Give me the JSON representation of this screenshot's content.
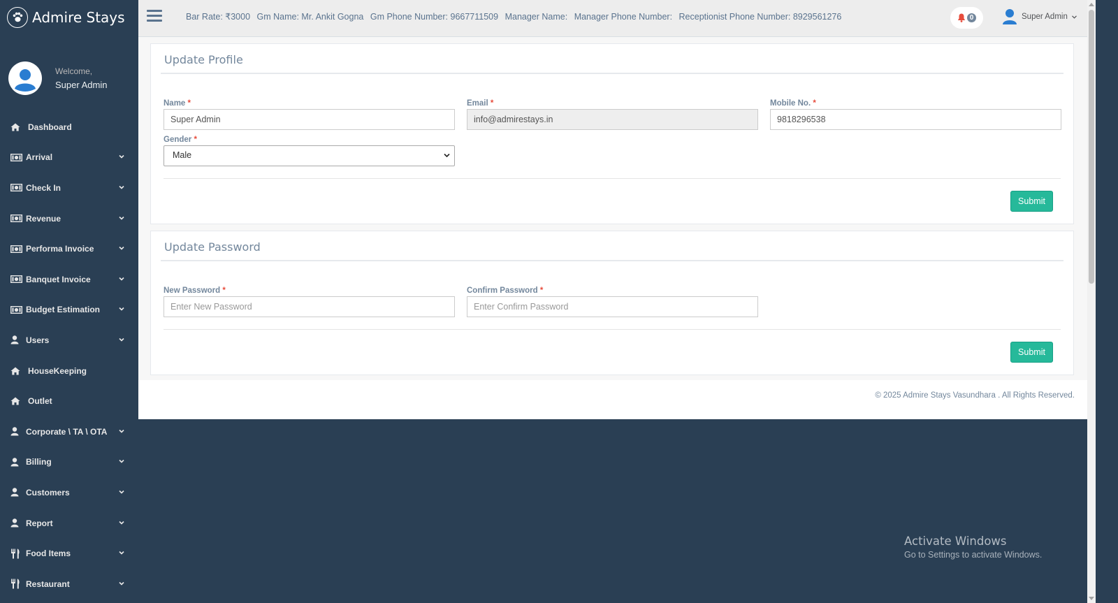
{
  "brand": {
    "name": "Admire Stays"
  },
  "profile": {
    "welcome": "Welcome,",
    "name": "Super Admin"
  },
  "sidebar": {
    "items": [
      {
        "label": "Dashboard",
        "icon": "home-icon",
        "has_children": false
      },
      {
        "label": "Arrival",
        "icon": "money-icon",
        "has_children": true
      },
      {
        "label": "Check In",
        "icon": "money-icon",
        "has_children": true
      },
      {
        "label": "Revenue",
        "icon": "money-icon",
        "has_children": true
      },
      {
        "label": "Performa Invoice",
        "icon": "money-icon",
        "has_children": true
      },
      {
        "label": "Banquet Invoice",
        "icon": "money-icon",
        "has_children": true
      },
      {
        "label": "Budget Estimation",
        "icon": "money-icon",
        "has_children": true
      },
      {
        "label": "Users",
        "icon": "user-icon",
        "has_children": true
      },
      {
        "label": "HouseKeeping",
        "icon": "home-icon",
        "has_children": false
      },
      {
        "label": "Outlet",
        "icon": "home-icon",
        "has_children": false
      },
      {
        "label": "Corporate \\ TA \\ OTA",
        "icon": "user-icon",
        "has_children": true
      },
      {
        "label": "Billing",
        "icon": "user-icon",
        "has_children": true
      },
      {
        "label": "Customers",
        "icon": "user-icon",
        "has_children": true
      },
      {
        "label": "Report",
        "icon": "user-icon",
        "has_children": true
      },
      {
        "label": "Food Items",
        "icon": "cutlery-icon",
        "has_children": true
      },
      {
        "label": "Restaurant",
        "icon": "cutlery-icon",
        "has_children": true
      }
    ]
  },
  "topbar": {
    "bar_rate": "Bar Rate: ₹3000",
    "gm_name": "Gm Name: Mr. Ankit Gogna",
    "gm_phone": "Gm Phone Number: 9667711509",
    "manager_name": "Manager Name:",
    "manager_phone": "Manager Phone Number:",
    "receptionist_phone": "Receptionist Phone Number: 8929561276",
    "notification_count": "0",
    "user_name": "Super Admin"
  },
  "profile_form": {
    "title": "Update Profile",
    "name_label": "Name",
    "name_value": "Super Admin",
    "email_label": "Email",
    "email_value": "info@admirestays.in",
    "mobile_label": "Mobile No.",
    "mobile_value": "9818296538",
    "gender_label": "Gender",
    "gender_value": "Male",
    "required_mark": "*",
    "submit_label": "Submit"
  },
  "password_form": {
    "title": "Update Password",
    "new_label": "New Password",
    "new_placeholder": "Enter New Password",
    "confirm_label": "Confirm Password",
    "confirm_placeholder": "Enter Confirm Password",
    "required_mark": "*",
    "submit_label": "Submit"
  },
  "footer": {
    "text": "© 2025 Admire Stays Vasundhara . All Rights Reserved."
  },
  "watermark": {
    "title": "Activate Windows",
    "subtitle": "Go to Settings to activate Windows."
  },
  "colors": {
    "sidebar_bg": "#2a3f54",
    "accent": "#26b99a",
    "required": "#e74c3c",
    "bell": "#e74c3c",
    "avatar": "#2a7dd1"
  }
}
